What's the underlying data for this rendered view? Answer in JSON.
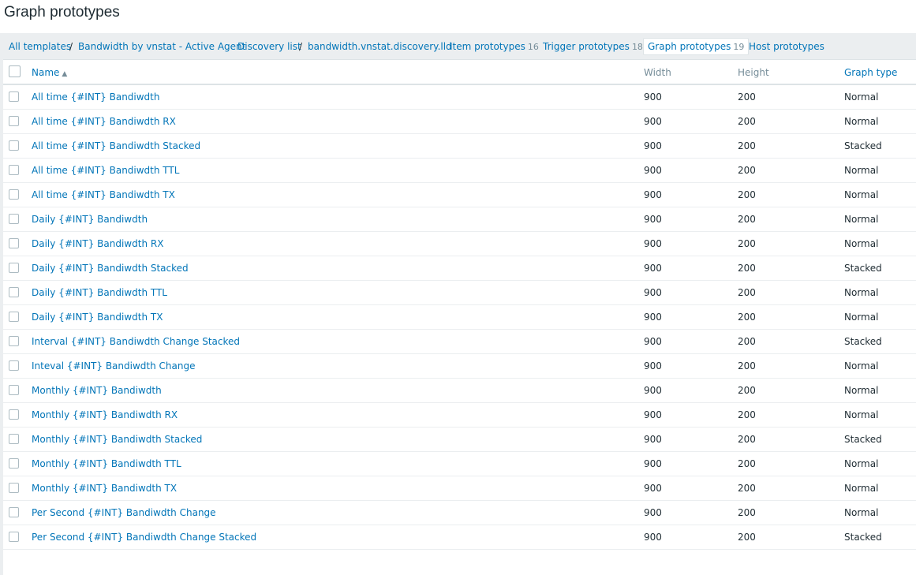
{
  "page": {
    "title": "Graph prototypes"
  },
  "nav": {
    "all_templates": "All templates",
    "separator": "/",
    "template": "Bandwidth by vnstat - Active Agent",
    "discovery_list": "Discovery list",
    "discovery_rule": "bandwidth.vnstat.discovery.lld",
    "item_prototypes": {
      "label": "Item prototypes",
      "count": "16"
    },
    "trigger_prototypes": {
      "label": "Trigger prototypes",
      "count": "18"
    },
    "graph_prototypes": {
      "label": "Graph prototypes",
      "count": "19"
    },
    "host_prototypes": "Host prototypes"
  },
  "table": {
    "headers": {
      "name": "Name",
      "width": "Width",
      "height": "Height",
      "graph_type": "Graph type"
    },
    "sort_indicator": "▲",
    "rows": [
      {
        "name": "All time {#INT} Bandiwdth",
        "width": "900",
        "height": "200",
        "type": "Normal"
      },
      {
        "name": "All time {#INT} Bandiwdth RX",
        "width": "900",
        "height": "200",
        "type": "Normal"
      },
      {
        "name": "All time {#INT} Bandiwdth Stacked",
        "width": "900",
        "height": "200",
        "type": "Stacked"
      },
      {
        "name": "All time {#INT} Bandiwdth TTL",
        "width": "900",
        "height": "200",
        "type": "Normal"
      },
      {
        "name": "All time {#INT} Bandiwdth TX",
        "width": "900",
        "height": "200",
        "type": "Normal"
      },
      {
        "name": "Daily {#INT} Bandiwdth",
        "width": "900",
        "height": "200",
        "type": "Normal"
      },
      {
        "name": "Daily {#INT} Bandiwdth RX",
        "width": "900",
        "height": "200",
        "type": "Normal"
      },
      {
        "name": "Daily {#INT} Bandiwdth Stacked",
        "width": "900",
        "height": "200",
        "type": "Stacked"
      },
      {
        "name": "Daily {#INT} Bandiwdth TTL",
        "width": "900",
        "height": "200",
        "type": "Normal"
      },
      {
        "name": "Daily {#INT} Bandiwdth TX",
        "width": "900",
        "height": "200",
        "type": "Normal"
      },
      {
        "name": "Interval {#INT} Bandiwdth Change Stacked",
        "width": "900",
        "height": "200",
        "type": "Stacked"
      },
      {
        "name": "Inteval {#INT} Bandiwdth Change",
        "width": "900",
        "height": "200",
        "type": "Normal"
      },
      {
        "name": "Monthly {#INT} Bandiwdth",
        "width": "900",
        "height": "200",
        "type": "Normal"
      },
      {
        "name": "Monthly {#INT} Bandiwdth RX",
        "width": "900",
        "height": "200",
        "type": "Normal"
      },
      {
        "name": "Monthly {#INT} Bandiwdth Stacked",
        "width": "900",
        "height": "200",
        "type": "Stacked"
      },
      {
        "name": "Monthly {#INT} Bandiwdth TTL",
        "width": "900",
        "height": "200",
        "type": "Normal"
      },
      {
        "name": "Monthly {#INT} Bandiwdth TX",
        "width": "900",
        "height": "200",
        "type": "Normal"
      },
      {
        "name": "Per Second {#INT} Bandiwdth Change",
        "width": "900",
        "height": "200",
        "type": "Normal"
      },
      {
        "name": "Per Second {#INT} Bandiwdth Change Stacked",
        "width": "900",
        "height": "200",
        "type": "Stacked"
      }
    ]
  }
}
